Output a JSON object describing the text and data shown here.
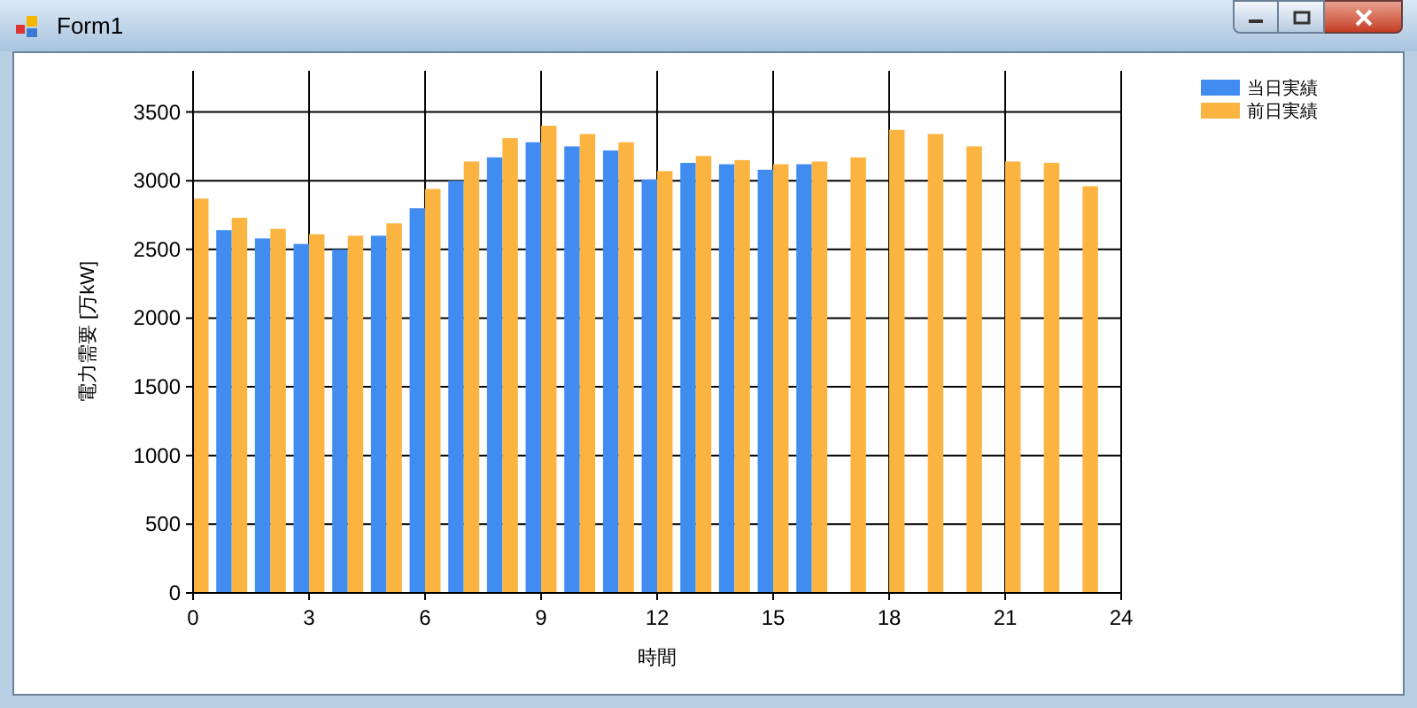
{
  "window": {
    "title": "Form1"
  },
  "chart": {
    "chart_data": {
      "type": "bar",
      "xlabel": "時間",
      "ylabel": "電力需要 [万kW]",
      "x": [
        0,
        1,
        2,
        3,
        4,
        5,
        6,
        7,
        8,
        9,
        10,
        11,
        12,
        13,
        14,
        15,
        16,
        17,
        18,
        19,
        20,
        21,
        22,
        23
      ],
      "xlim": [
        0,
        24
      ],
      "ylim": [
        0,
        3800
      ],
      "xticks": [
        0,
        3,
        6,
        9,
        12,
        15,
        18,
        21,
        24
      ],
      "yticks": [
        0,
        500,
        1000,
        1500,
        2000,
        2500,
        3000,
        3500
      ],
      "grid": true,
      "legend": true,
      "series": [
        {
          "name": "当日実績",
          "color": "#418cf0",
          "values": [
            null,
            2640,
            2580,
            2540,
            2500,
            2600,
            2800,
            3000,
            3170,
            3280,
            3250,
            3220,
            3010,
            3130,
            3120,
            3080,
            3120,
            null,
            null,
            null,
            null,
            null,
            null,
            null
          ]
        },
        {
          "name": "前日実績",
          "color": "#fcb441",
          "values": [
            2870,
            2730,
            2650,
            2610,
            2600,
            2690,
            2940,
            3140,
            3310,
            3400,
            3340,
            3280,
            3070,
            3180,
            3150,
            3120,
            3140,
            3170,
            3370,
            3340,
            3250,
            3140,
            3130,
            2960
          ]
        }
      ]
    }
  }
}
